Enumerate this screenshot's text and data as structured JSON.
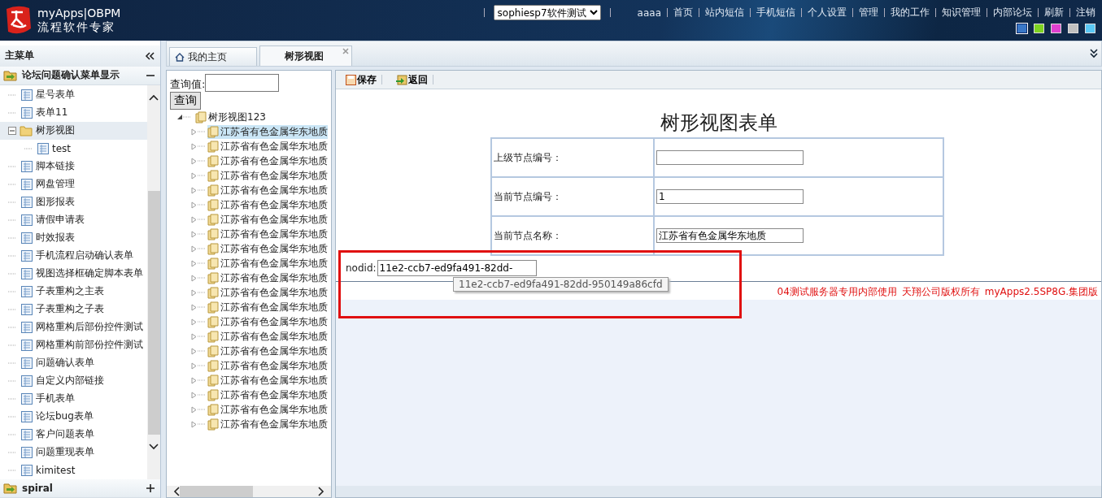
{
  "header": {
    "app_name": "myApps|OBPM",
    "tagline": "流程软件专家",
    "account_select": "sophiesp7软件测试",
    "nav": [
      "aaaa",
      "首页",
      "站内短信",
      "手机短信",
      "个人设置",
      "管理",
      "我的工作",
      "知识管理",
      "内部论坛",
      "刷新",
      "注销"
    ],
    "themes": [
      {
        "color": "#3a78c8",
        "selected": true
      },
      {
        "color": "#7ed321",
        "selected": false
      },
      {
        "color": "#e040d0",
        "selected": false
      },
      {
        "color": "#c0c0c0",
        "selected": false
      },
      {
        "color": "#5ac8f5",
        "selected": false
      }
    ]
  },
  "tabs": [
    {
      "label": "我的主页",
      "kind": "home",
      "selected": false
    },
    {
      "label": "树形视图",
      "kind": "closable",
      "selected": true
    }
  ],
  "sidebar": {
    "title": "主菜单",
    "groups": [
      {
        "label": "论坛问题确认菜单显示",
        "expanded": true,
        "items": [
          {
            "label": "星号表单",
            "kind": "form",
            "selected": false
          },
          {
            "label": "表单11",
            "kind": "form",
            "selected": false
          },
          {
            "label": "树形视图",
            "kind": "folder",
            "selected": true,
            "expanded": true,
            "children": [
              {
                "label": "test",
                "kind": "form",
                "selected": false
              }
            ]
          },
          {
            "label": "脚本链接",
            "kind": "form",
            "selected": false
          },
          {
            "label": "网盘管理",
            "kind": "form",
            "selected": false
          },
          {
            "label": "图形报表",
            "kind": "form",
            "selected": false
          },
          {
            "label": "请假申请表",
            "kind": "form",
            "selected": false
          },
          {
            "label": "时效报表",
            "kind": "form",
            "selected": false
          },
          {
            "label": "手机流程启动确认表单",
            "kind": "form",
            "selected": false
          },
          {
            "label": "视图选择框确定脚本表单",
            "kind": "form",
            "selected": false
          },
          {
            "label": "子表重构之主表",
            "kind": "form",
            "selected": false
          },
          {
            "label": "子表重构之子表",
            "kind": "form",
            "selected": false
          },
          {
            "label": "网格重构后部份控件测试",
            "kind": "form",
            "selected": false
          },
          {
            "label": "网格重构前部份控件测试",
            "kind": "form",
            "selected": false
          },
          {
            "label": "问题确认表单",
            "kind": "form",
            "selected": false
          },
          {
            "label": "自定义内部链接",
            "kind": "form",
            "selected": false
          },
          {
            "label": "手机表单",
            "kind": "form",
            "selected": false
          },
          {
            "label": "论坛bug表单",
            "kind": "form",
            "selected": false
          },
          {
            "label": "客户问题表单",
            "kind": "form",
            "selected": false
          },
          {
            "label": "问题重现表单",
            "kind": "form",
            "selected": false
          },
          {
            "label": "kimitest",
            "kind": "form",
            "selected": false
          }
        ]
      },
      {
        "label": "spiral",
        "expanded": false
      }
    ]
  },
  "tree": {
    "search_label": "查询值:",
    "search_button": "查询",
    "root": {
      "label": "树形视图123",
      "expanded": true,
      "children": [
        {
          "label": "江苏省有色金属华东地质",
          "selected": true
        },
        {
          "label": "江苏省有色金属华东地质",
          "selected": false
        },
        {
          "label": "江苏省有色金属华东地质",
          "selected": false
        },
        {
          "label": "江苏省有色金属华东地质",
          "selected": false
        },
        {
          "label": "江苏省有色金属华东地质",
          "selected": false
        },
        {
          "label": "江苏省有色金属华东地质",
          "selected": false
        },
        {
          "label": "江苏省有色金属华东地质",
          "selected": false
        },
        {
          "label": "江苏省有色金属华东地质",
          "selected": false
        },
        {
          "label": "江苏省有色金属华东地质",
          "selected": false
        },
        {
          "label": "江苏省有色金属华东地质",
          "selected": false
        },
        {
          "label": "江苏省有色金属华东地质",
          "selected": false
        },
        {
          "label": "江苏省有色金属华东地质",
          "selected": false
        },
        {
          "label": "江苏省有色金属华东地质",
          "selected": false
        },
        {
          "label": "江苏省有色金属华东地质",
          "selected": false
        },
        {
          "label": "江苏省有色金属华东地质",
          "selected": false
        },
        {
          "label": "江苏省有色金属华东地质",
          "selected": false
        },
        {
          "label": "江苏省有色金属华东地质",
          "selected": false
        },
        {
          "label": "江苏省有色金属华东地质",
          "selected": false
        },
        {
          "label": "江苏省有色金属华东地质",
          "selected": false
        },
        {
          "label": "江苏省有色金属华东地质",
          "selected": false
        },
        {
          "label": "江苏省有色金属华东地质",
          "selected": false
        }
      ]
    }
  },
  "form": {
    "toolbar": [
      {
        "label": "保存",
        "kind": "save"
      },
      {
        "label": "返回",
        "kind": "back"
      }
    ],
    "title": "树形视图表单",
    "fields": [
      {
        "label": "上级节点编号："
      },
      {
        "label": "当前节点编号：",
        "value": "1"
      },
      {
        "label": "当前节点名称：",
        "value": "江苏省有色金属华东地质"
      }
    ],
    "nodid": {
      "label": "nodid:",
      "value": "11e2-ccb7-ed9fa491-82dd-",
      "tooltip": "11e2-ccb7-ed9fa491-82dd-950149a86cfd"
    },
    "footer": [
      "04测试服务器专用内部使用",
      "天翔公司版权所有",
      "myApps2.5SP8G.集团版"
    ]
  }
}
